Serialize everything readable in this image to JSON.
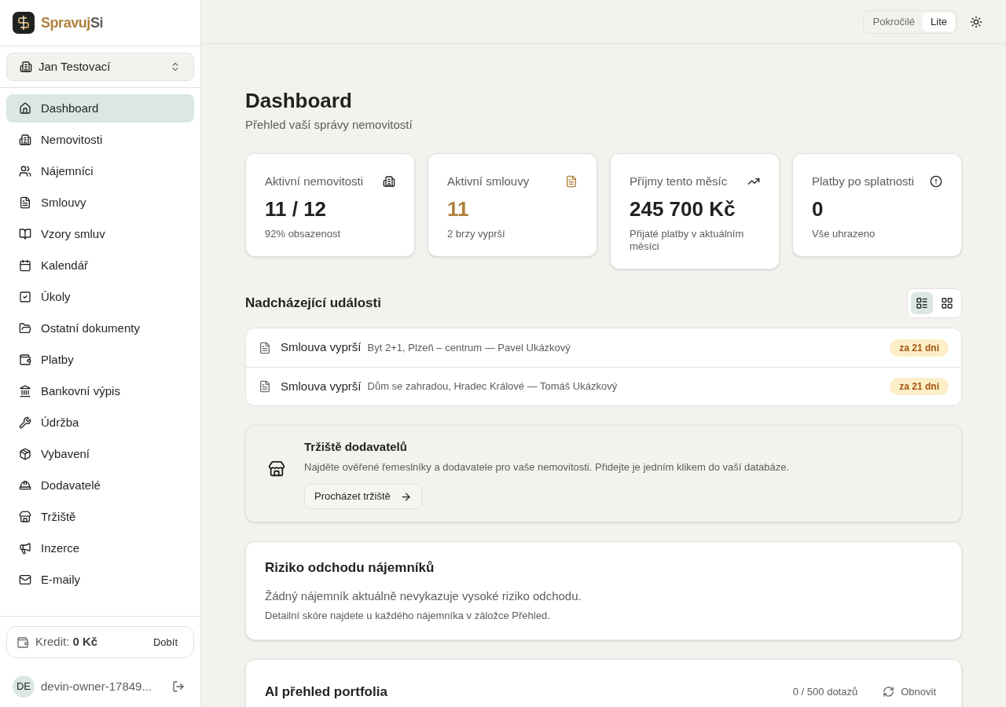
{
  "brand": {
    "part_1": "Spravuj",
    "part_2": "Si"
  },
  "account_switcher": {
    "label": "Jan Testovací"
  },
  "nav": [
    {
      "label": "Dashboard",
      "selected": true
    },
    {
      "label": "Nemovitosti",
      "selected": false
    },
    {
      "label": "Nájemníci",
      "selected": false
    },
    {
      "label": "Smlouvy",
      "selected": false
    },
    {
      "label": "Vzory smluv",
      "selected": false
    },
    {
      "label": "Kalendář",
      "selected": false
    },
    {
      "label": "Úkoly",
      "selected": false
    },
    {
      "label": "Ostatní dokumenty",
      "selected": false
    },
    {
      "label": "Platby",
      "selected": false
    },
    {
      "label": "Bankovní výpis",
      "selected": false
    },
    {
      "label": "Údržba",
      "selected": false
    },
    {
      "label": "Vybavení",
      "selected": false
    },
    {
      "label": "Dodavatelé",
      "selected": false
    },
    {
      "label": "Tržiště",
      "selected": false
    },
    {
      "label": "Inzerce",
      "selected": false
    },
    {
      "label": "E-maily",
      "selected": false
    }
  ],
  "credit": {
    "label": "Kredit:",
    "amount": "0 Kč",
    "button": "Dobít"
  },
  "user": {
    "initials": "DE",
    "name": "devin-owner-17849..."
  },
  "mode_toggle": [
    {
      "label": "Pokročilé",
      "selected": false
    },
    {
      "label": "Lite",
      "selected": true
    }
  ],
  "page": {
    "title": "Dashboard",
    "subtitle": "Přehled vaší správy nemovitostí"
  },
  "stats": [
    {
      "title": "Aktivní nemovitosti",
      "value": "11 / 12",
      "note": "92% obsazenost",
      "accent": false
    },
    {
      "title": "Aktivní smlouvy",
      "value": "11",
      "note": "2 brzy vyprší",
      "accent": true
    },
    {
      "title": "Příjmy tento měsíc",
      "value": "245 700 Kč",
      "note": "Přijaté platby v aktuálním měsíci",
      "accent": false
    },
    {
      "title": "Platby po splatnosti",
      "value": "0",
      "note": "Vše uhrazeno",
      "accent": false
    }
  ],
  "events": {
    "title": "Nadcházející události",
    "views": [
      {
        "kind": "list",
        "selected": true
      },
      {
        "kind": "grid",
        "selected": false
      }
    ],
    "items": [
      {
        "title": "Smlouva vyprší",
        "detail": "Byt 2+1, Plzeň – centrum — Pavel Ukázkový",
        "badge": "za 21 dni"
      },
      {
        "title": "Smlouva vyprší",
        "detail": "Dům se zahradou, Hradec Králové — Tomáš Ukázkový",
        "badge": "za 21 dni"
      }
    ]
  },
  "marketplace": {
    "title": "Tržiště dodavatelů",
    "text": "Najděte ověřené řemeslníky a dodavatele pro vaše nemovitosti. Přidejte je jedním klikem do vaší databáze.",
    "button": "Procházet tržiště"
  },
  "churn": {
    "title": "Riziko odchodu nájemníků",
    "text": "Žádný nájemník aktuálně nevykazuje vysoké riziko odchodu.",
    "note": "Detailní skóre najdete u každého nájemníka v záložce Přehled."
  },
  "ai": {
    "title": "AI přehled portfolia",
    "usage": "0 / 500 dotazů",
    "button": "Obnovit"
  }
}
